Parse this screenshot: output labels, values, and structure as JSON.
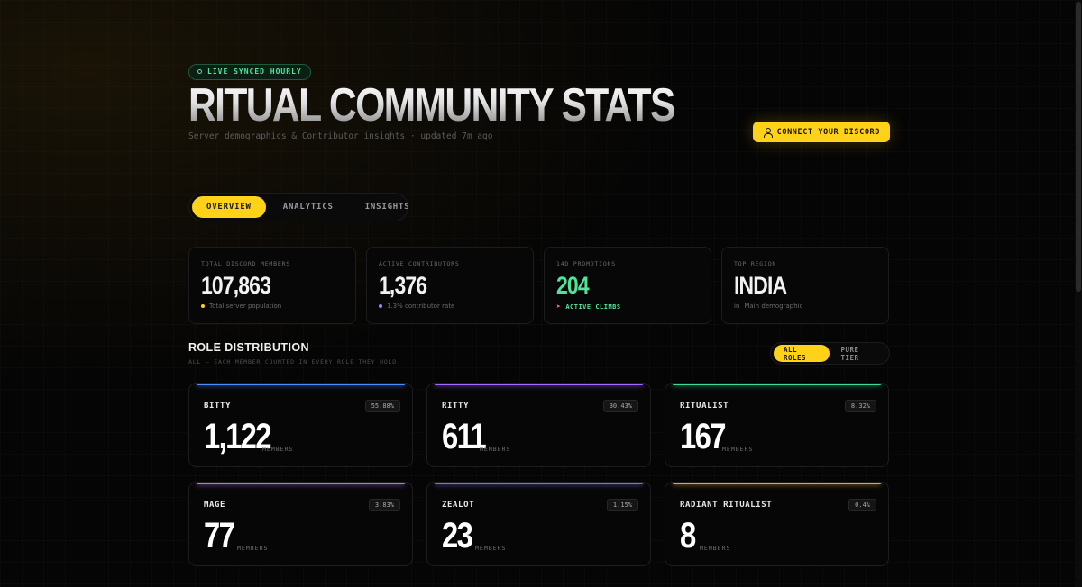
{
  "header": {
    "live_badge": "LIVE SYNCED HOURLY",
    "title": "RITUAL COMMUNITY STATS",
    "subtitle": "Server demographics & Contributor insights · updated 7m ago",
    "connect_label": "CONNECT YOUR DISCORD"
  },
  "tabs": [
    {
      "label": "OVERVIEW",
      "active": true
    },
    {
      "label": "ANALYTICS",
      "active": false
    },
    {
      "label": "INSIGHTS",
      "active": false
    }
  ],
  "kpis": [
    {
      "label": "TOTAL DISCORD MEMBERS",
      "value": "107,863",
      "sub": "Total server population",
      "dot_color": "#ffd21a"
    },
    {
      "label": "ACTIVE CONTRIBUTORS",
      "value": "1,376",
      "sub": "1.3% contributor rate",
      "dot_color": "#8f8cff"
    },
    {
      "label": "14D PROMOTIONS",
      "value": "204",
      "sub": "ACTIVE CLIMBS",
      "icon": "rocket-icon"
    },
    {
      "label": "TOP REGION",
      "value": "INDIA",
      "sub": "Main demographic",
      "flag_code": "in"
    }
  ],
  "roles_section": {
    "title": "ROLE DISTRIBUTION",
    "subtitle": "ALL — EACH MEMBER COUNTED IN EVERY ROLE THEY HOLD",
    "filters": [
      {
        "label": "ALL ROLES",
        "active": true
      },
      {
        "label": "PURE TIER",
        "active": false
      }
    ],
    "unit_label": "MEMBERS",
    "roles": [
      {
        "name": "BITTY",
        "pct": "55.88%",
        "count": "1,122",
        "color": "#4f8dff"
      },
      {
        "name": "RITTY",
        "pct": "30.43%",
        "count": "611",
        "color": "#a06bff"
      },
      {
        "name": "RITUALIST",
        "pct": "8.32%",
        "count": "167",
        "color": "#3ed996"
      },
      {
        "name": "MAGE",
        "pct": "3.83%",
        "count": "77",
        "color": "#c06bff"
      },
      {
        "name": "ZEALOT",
        "pct": "1.15%",
        "count": "23",
        "color": "#7b6bff"
      },
      {
        "name": "RADIANT RITUALIST",
        "pct": "0.4%",
        "count": "8",
        "color": "#e8a33d"
      }
    ]
  }
}
